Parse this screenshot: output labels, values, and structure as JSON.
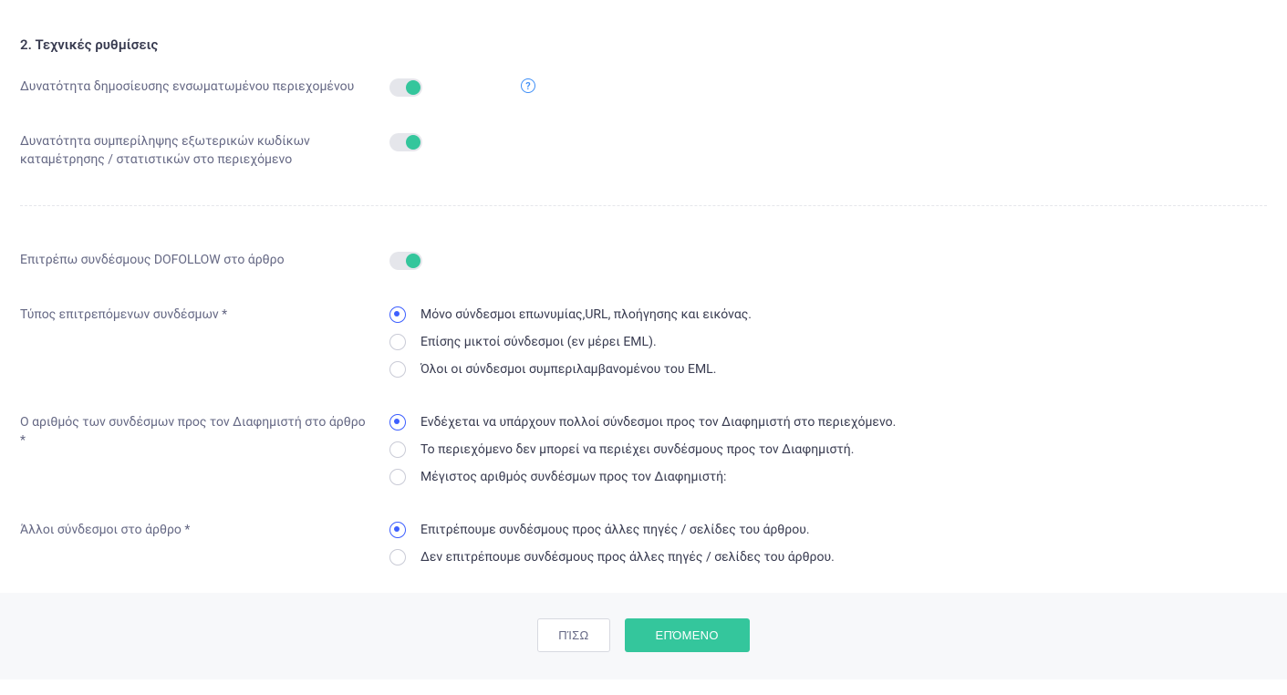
{
  "section": {
    "title": "2. Τεχνικές ρυθμίσεις"
  },
  "toggle_rows": {
    "embedded": {
      "label": "Δυνατότητα δημοσίευσης ενσωματωμένου περιεχομένου",
      "on": true,
      "help": true
    },
    "tracking": {
      "label": "Δυνατότητα συμπερίληψης εξωτερικών κωδίκων καταμέτρησης / στατιστικών στο περιεχόμενο",
      "on": true,
      "help": false
    },
    "dofollow": {
      "label": "Επιτρέπω συνδέσμους DOFOLLOW στο άρθρο",
      "on": true,
      "help": false
    }
  },
  "link_types": {
    "label": "Τύπος επιτρεπόμενων συνδέσμων *",
    "options": [
      {
        "label": "Μόνο σύνδεσμοι επωνυμίας,URL, πλοήγησης και εικόνας.",
        "selected": true
      },
      {
        "label": "Επίσης μικτοί σύνδεσμοι (εν μέρει EML).",
        "selected": false
      },
      {
        "label": "Όλοι οι σύνδεσμοι συμπεριλαμβανομένου του EML.",
        "selected": false
      }
    ]
  },
  "link_count": {
    "label": "Ο αριθμός των συνδέσμων προς τον Διαφημιστή στο άρθρο *",
    "options": [
      {
        "label": "Ενδέχεται να υπάρχουν πολλοί σύνδεσμοι προς τον Διαφημιστή στο περιεχόμενο.",
        "selected": true
      },
      {
        "label": "Το περιεχόμενο δεν μπορεί να περιέχει συνδέσμους προς τον Διαφημιστή.",
        "selected": false
      },
      {
        "label": "Μέγιστος αριθμός συνδέσμων προς τον Διαφημιστή:",
        "selected": false
      }
    ]
  },
  "other_links": {
    "label": "Άλλοι σύνδεσμοι στο άρθρο *",
    "options": [
      {
        "label": "Επιτρέπουμε συνδέσμους προς άλλες πηγές / σελίδες του άρθρου.",
        "selected": true
      },
      {
        "label": "Δεν επιτρέπουμε συνδέσμους προς άλλες πηγές / σελίδες του άρθρου.",
        "selected": false
      }
    ]
  },
  "footer": {
    "back": "ΠΊΣΩ",
    "next": "ΕΠΌΜΕΝΟ"
  }
}
